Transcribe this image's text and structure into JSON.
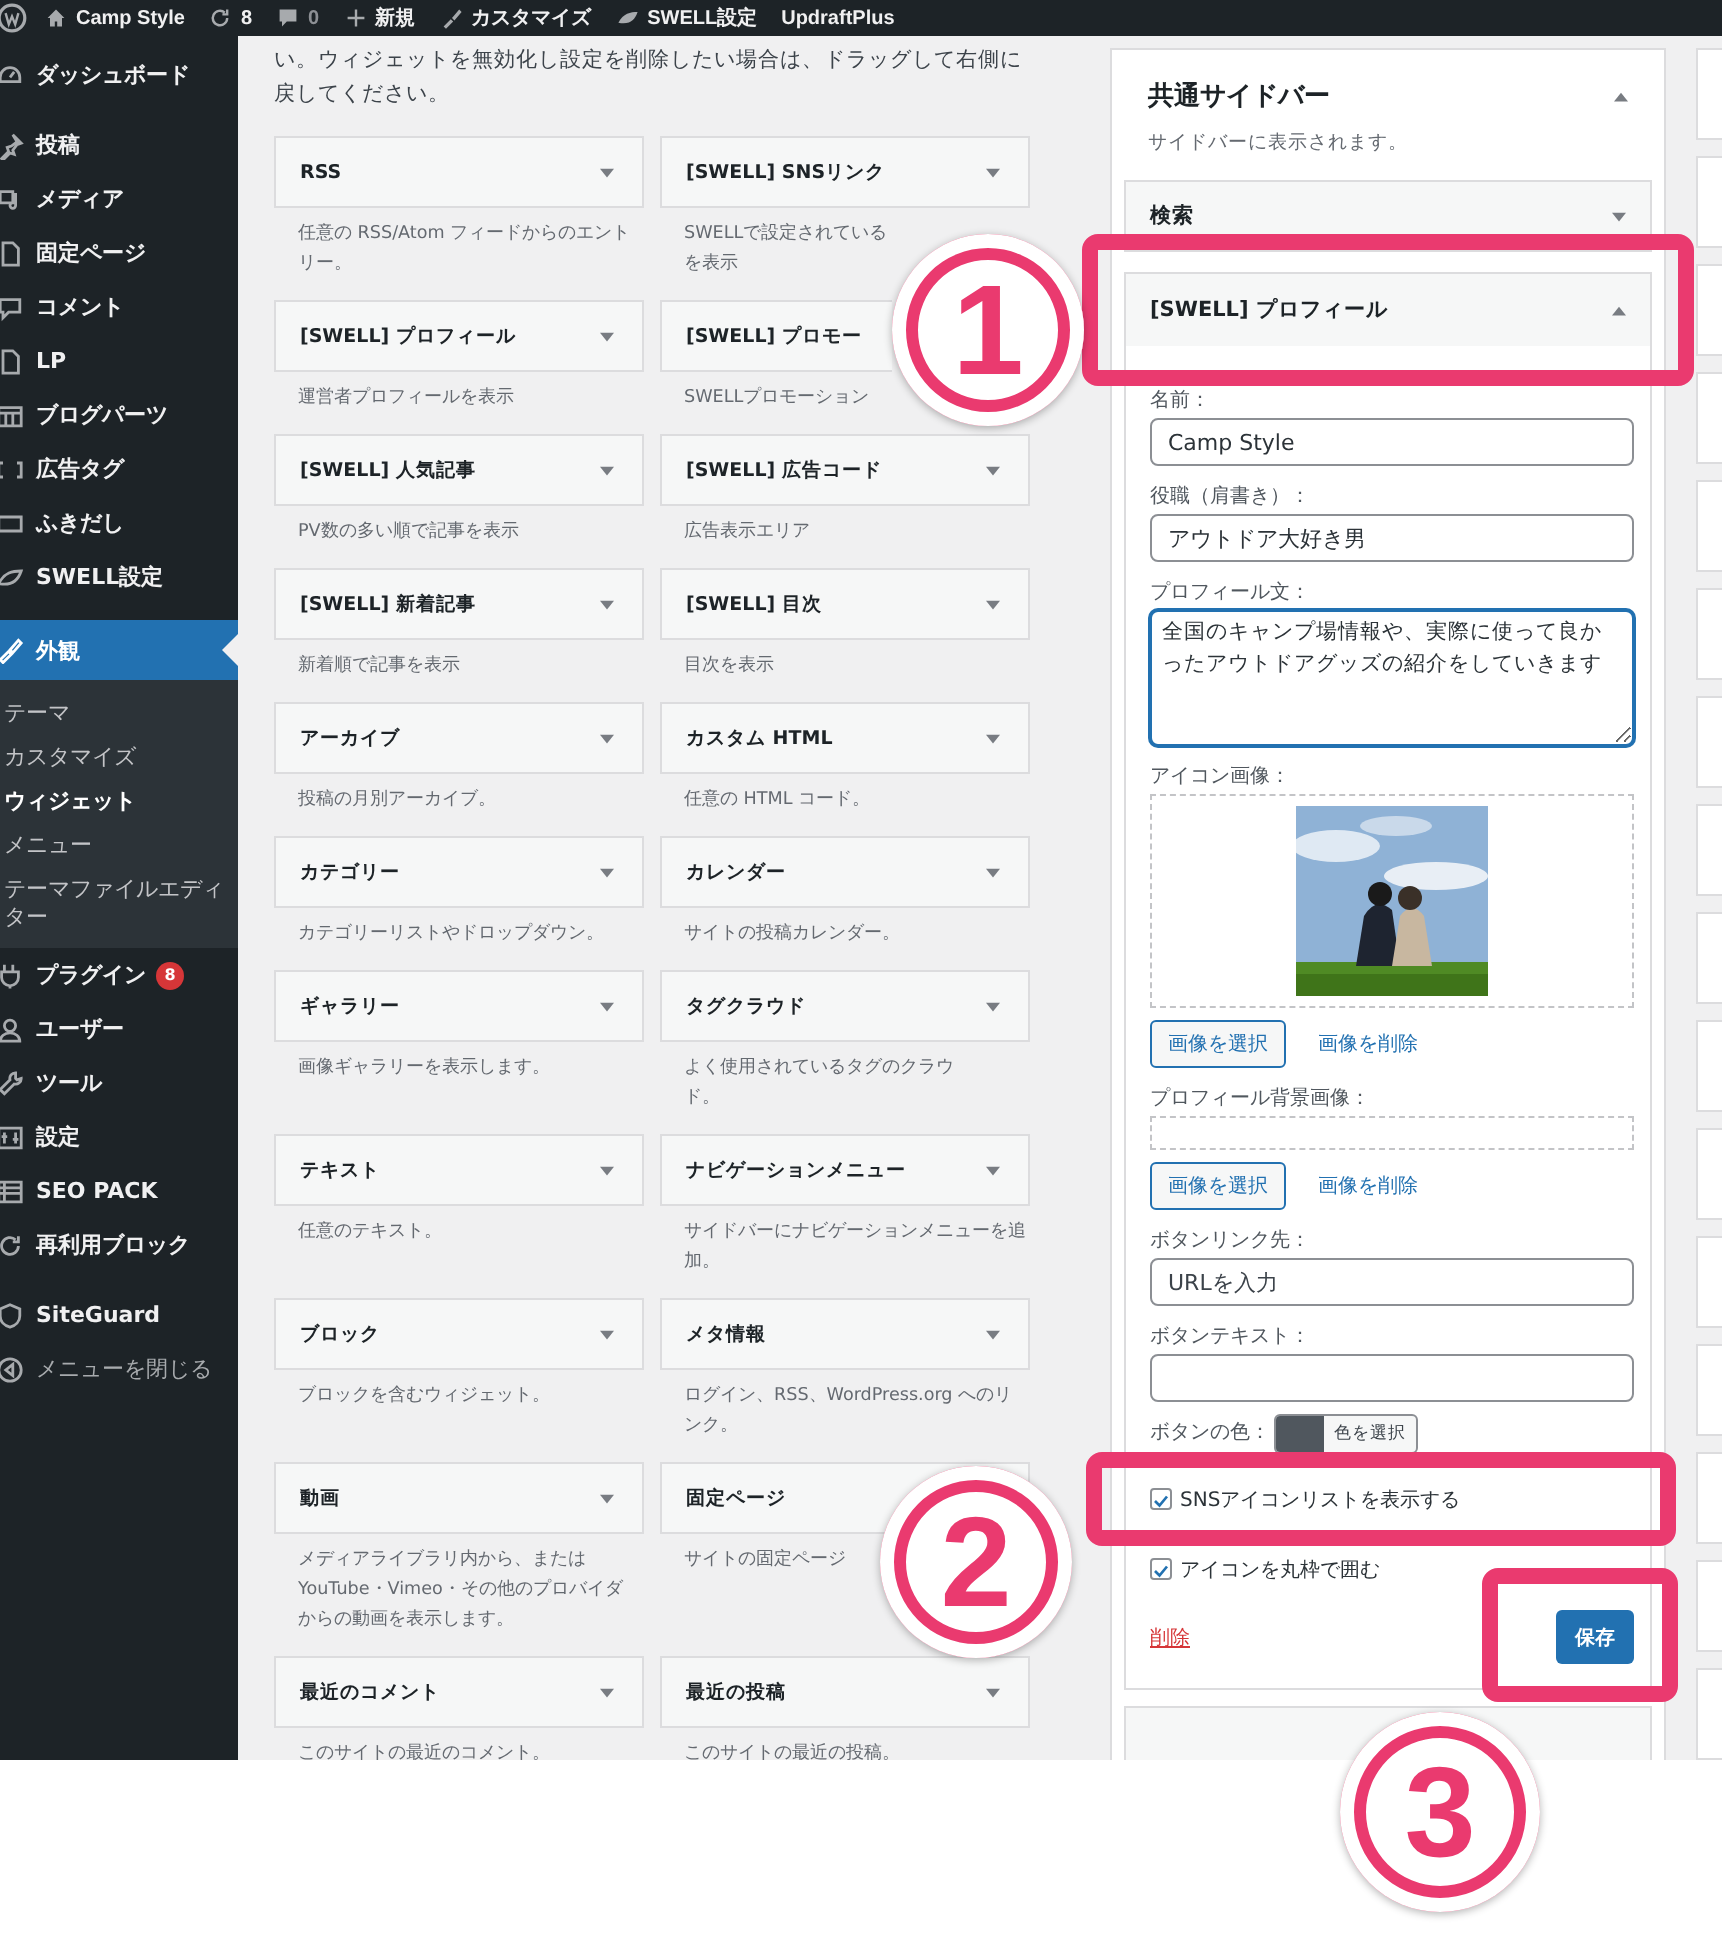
{
  "admin_bar": {
    "items": [
      {
        "label": "Camp Style"
      },
      {
        "label": "8"
      },
      {
        "label": "0"
      },
      {
        "label": "新規"
      },
      {
        "label": "カスタマイズ"
      },
      {
        "label": "SWELL設定"
      },
      {
        "label": "UpdraftPlus"
      }
    ]
  },
  "sidebar": {
    "groups": [
      {
        "items": [
          {
            "label": "ダッシュボード",
            "selected": false
          }
        ]
      },
      {
        "items": [
          {
            "label": "投稿",
            "selected": false
          },
          {
            "label": "メディア",
            "selected": false
          },
          {
            "label": "固定ページ",
            "selected": false
          },
          {
            "label": "コメント",
            "selected": false
          },
          {
            "label": "LP",
            "selected": false
          },
          {
            "label": "ブログパーツ",
            "selected": false
          },
          {
            "label": "広告タグ",
            "selected": false
          },
          {
            "label": "ふきだし",
            "selected": false
          },
          {
            "label": "SWELL設定",
            "selected": false
          }
        ]
      },
      {
        "items": [
          {
            "label": "外観",
            "selected": true,
            "children": [
              {
                "label": "テーマ",
                "selected": false
              },
              {
                "label": "カスタマイズ",
                "selected": false
              },
              {
                "label": "ウィジェット",
                "selected": true
              },
              {
                "label": "メニュー",
                "selected": false
              },
              {
                "label": "テーマファイルエディター",
                "selected": false
              }
            ]
          },
          {
            "label": "プラグイン",
            "selected": false,
            "badge": "8"
          },
          {
            "label": "ユーザー",
            "selected": false
          },
          {
            "label": "ツール",
            "selected": false
          },
          {
            "label": "設定",
            "selected": false
          },
          {
            "label": "SEO PACK",
            "selected": false
          },
          {
            "label": "再利用ブロック",
            "selected": false
          }
        ]
      },
      {
        "items": [
          {
            "label": "SiteGuard",
            "selected": false
          },
          {
            "label": "メニューを閉じる",
            "selected": false,
            "kind": "collapse"
          }
        ]
      }
    ]
  },
  "intro_text": "い。ウィジェットを無効化し設定を削除したい場合は、ドラッグして右側に戻してください。",
  "available_widgets": [
    {
      "title": "RSS",
      "description": "任意の RSS/Atom フィードからのエントリー。"
    },
    {
      "title": "[SWELL] SNSリンク",
      "description": [
        "SWELLで設定されている",
        "を表示"
      ]
    },
    {
      "title": "[SWELL] プロフィール",
      "description": "運営者プロフィールを表示"
    },
    {
      "title": "[SWELL] プロモー",
      "description": "SWELLプロモーション"
    },
    {
      "title": "[SWELL] 人気記事",
      "description": "PV数の多い順で記事を表示"
    },
    {
      "title": "[SWELL] 広告コード",
      "description": "広告表示エリア"
    },
    {
      "title": "[SWELL] 新着記事",
      "description": "新着順で記事を表示"
    },
    {
      "title": "[SWELL] 目次",
      "description": "目次を表示"
    },
    {
      "title": "アーカイブ",
      "description": "投稿の月別アーカイブ。"
    },
    {
      "title": "カスタム HTML",
      "description": "任意の HTML コード。"
    },
    {
      "title": "カテゴリー",
      "description": "カテゴリーリストやドロップダウン。"
    },
    {
      "title": "カレンダー",
      "description": "サイトの投稿カレンダー。"
    },
    {
      "title": "ギャラリー",
      "description": "画像ギャラリーを表示します。"
    },
    {
      "title": "タグクラウド",
      "description": [
        "よく使用されているタグのクラウ",
        "ド。"
      ]
    },
    {
      "title": "テキスト",
      "description": "任意のテキスト。"
    },
    {
      "title": "ナビゲーションメニュー",
      "description": "サイドバーにナビゲーションメニューを追加。"
    },
    {
      "title": "ブロック",
      "description": "ブロックを含むウィジェット。"
    },
    {
      "title": "メタ情報",
      "description": "ログイン、RSS、WordPress.org へのリンク。"
    },
    {
      "title": "動画",
      "description": "メディアライブラリ内から、または YouTube・Vimeo・その他のプロバイダからの動画を表示します。"
    },
    {
      "title": "固定ページ",
      "description": "サイトの固定ページ"
    },
    {
      "title": "最近のコメント",
      "description": "このサイトの最近のコメント。"
    },
    {
      "title": "最近の投稿",
      "description": "このサイトの最近の投稿。"
    }
  ],
  "sidebar_area": {
    "title": "共通サイドバー",
    "description": "サイドバーに表示されます。",
    "widgets": [
      {
        "title": "検索",
        "expanded": false
      },
      {
        "title": "[SWELL] プロフィール",
        "expanded": true
      }
    ],
    "form": {
      "fields": [
        {
          "kind": "text",
          "label": "名前：",
          "value": "Camp Style"
        },
        {
          "kind": "text",
          "label": "役職（肩書き）：",
          "value": "アウトドア大好き男"
        },
        {
          "kind": "textarea",
          "label": "プロフィール文：",
          "value": "全国のキャンプ場情報や、実際に使って良かったアウトドアグッズの紹介をしていきます"
        },
        {
          "label": "アイコン画像：",
          "has_picture": true,
          "select": "画像を選択",
          "remove": "画像を削除"
        },
        {
          "label": "プロフィール背景画像：",
          "has_picture": false,
          "select": "画像を選択",
          "remove": "画像を削除"
        },
        {
          "kind": "text",
          "label": "ボタンリンク先：",
          "placeholder": "URLを入力"
        },
        {
          "kind": "text",
          "label": "ボタンテキスト："
        },
        {
          "kind": "color",
          "label": "ボタンの色：",
          "button": "色を選択"
        }
      ],
      "checkboxes": [
        {
          "label": "SNSアイコンリストを表示する",
          "checked": true
        },
        {
          "label": "アイコンを丸枠で囲む",
          "checked": true
        }
      ],
      "delete_link": "削除",
      "save_button": "保存"
    }
  },
  "annotations": [
    {
      "label": "1"
    },
    {
      "label": "2"
    },
    {
      "label": "3"
    }
  ]
}
